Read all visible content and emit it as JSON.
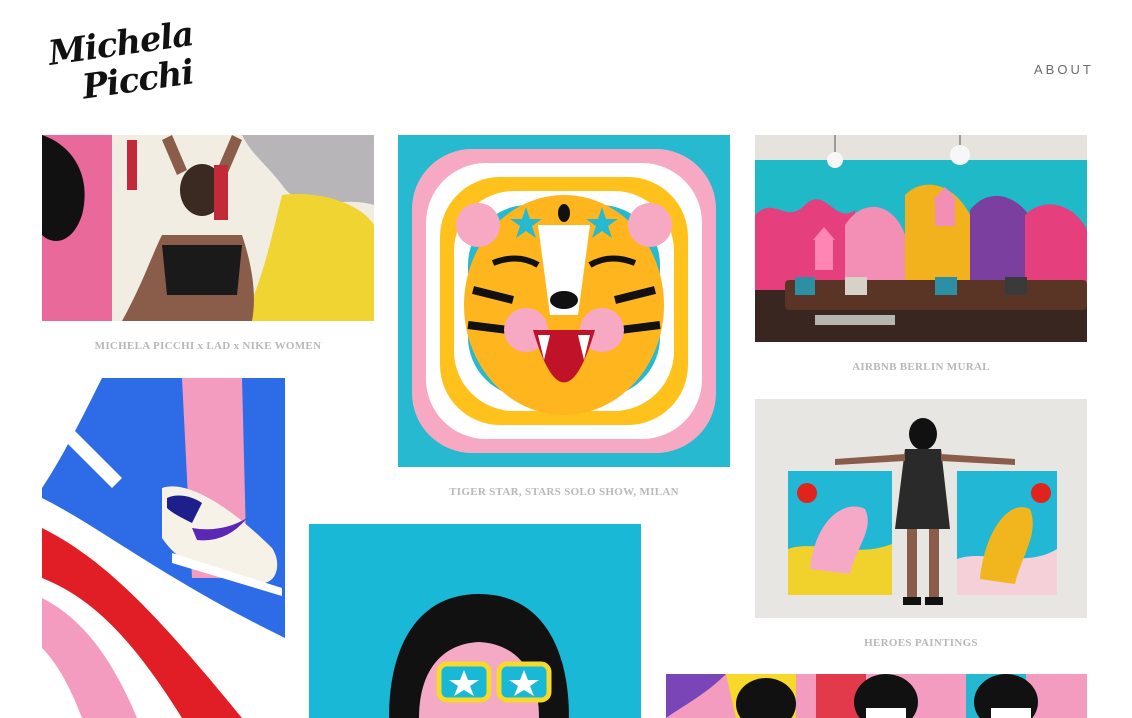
{
  "header": {
    "logo_line1": "Michela",
    "logo_line2": "Picchi",
    "nav_about": "ABOUT"
  },
  "projects": [
    {
      "caption": "MICHELA PICCHI x LAD x NIKE WOMEN"
    },
    {
      "caption": "TIGER STAR, STARS SOLO SHOW, MILAN"
    },
    {
      "caption": "AIRBNB BERLIN MURAL"
    },
    {
      "caption": "HEROES PAINTINGS"
    }
  ]
}
